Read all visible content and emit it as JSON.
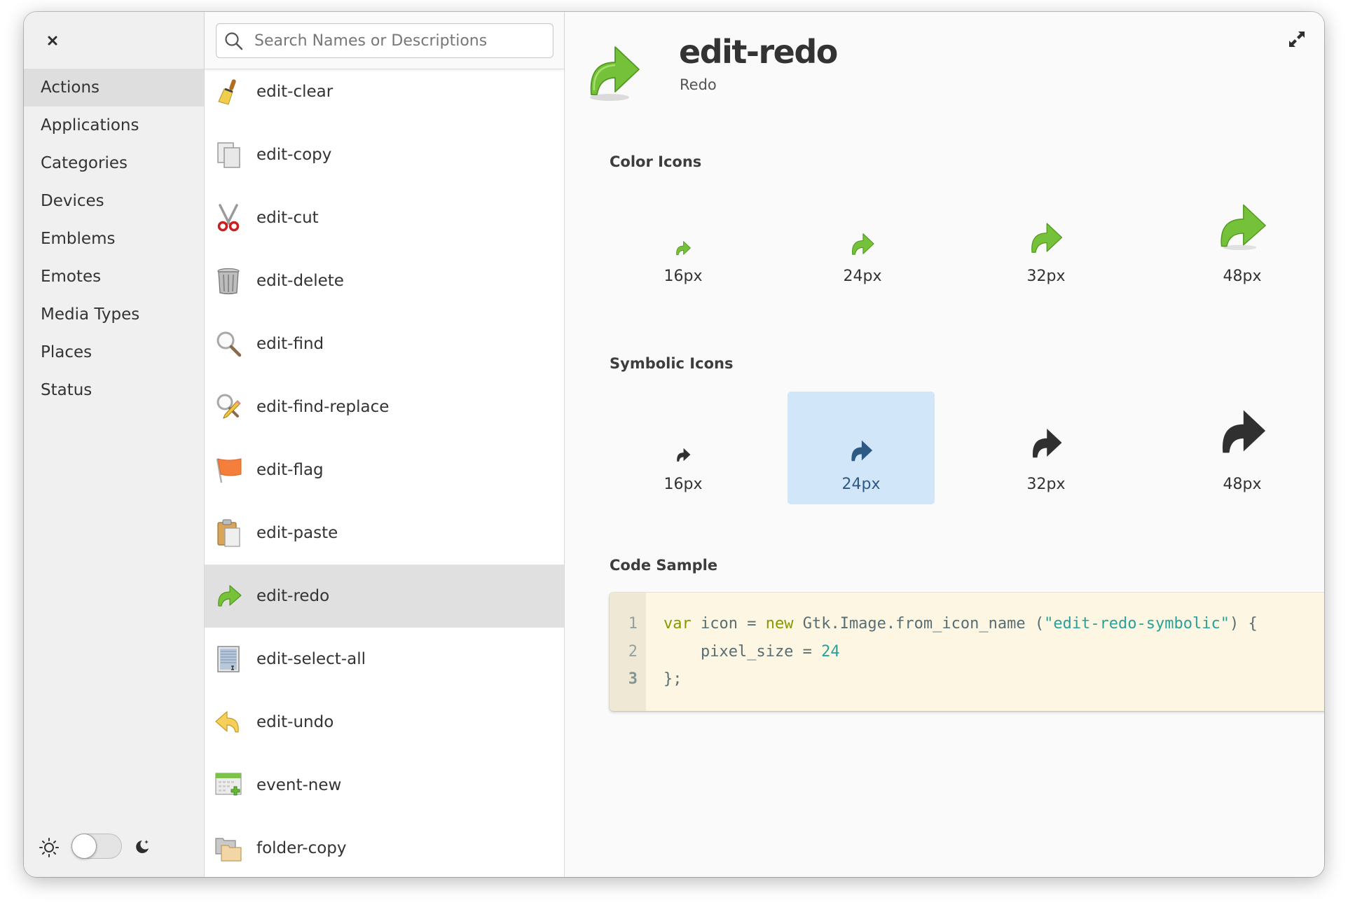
{
  "window": {
    "close_label": "close",
    "expand_label": "expand"
  },
  "sidebar": {
    "items": [
      {
        "label": "Actions",
        "active": true
      },
      {
        "label": "Applications"
      },
      {
        "label": "Categories"
      },
      {
        "label": "Devices"
      },
      {
        "label": "Emblems"
      },
      {
        "label": "Emotes"
      },
      {
        "label": "Media Types"
      },
      {
        "label": "Places"
      },
      {
        "label": "Status"
      }
    ],
    "theme_toggle": {
      "dark_mode": false,
      "light_icon": "sun-icon",
      "dark_icon": "moon-icon"
    }
  },
  "search": {
    "placeholder": "Search Names or Descriptions",
    "value": ""
  },
  "icon_list": [
    {
      "name": "edit-clear",
      "icon": "broom-icon"
    },
    {
      "name": "edit-copy",
      "icon": "copy-icon"
    },
    {
      "name": "edit-cut",
      "icon": "scissors-icon"
    },
    {
      "name": "edit-delete",
      "icon": "trash-icon"
    },
    {
      "name": "edit-find",
      "icon": "magnifier-icon"
    },
    {
      "name": "edit-find-replace",
      "icon": "find-replace-icon"
    },
    {
      "name": "edit-flag",
      "icon": "flag-icon"
    },
    {
      "name": "edit-paste",
      "icon": "clipboard-icon"
    },
    {
      "name": "edit-redo",
      "icon": "redo-arrow-icon",
      "selected": true
    },
    {
      "name": "edit-select-all",
      "icon": "select-all-icon"
    },
    {
      "name": "edit-undo",
      "icon": "undo-arrow-icon"
    },
    {
      "name": "event-new",
      "icon": "calendar-add-icon"
    },
    {
      "name": "folder-copy",
      "icon": "folder-copy-icon"
    }
  ],
  "detail": {
    "title": "edit-redo",
    "subtitle": "Redo",
    "color_heading": "Color Icons",
    "symbolic_heading": "Symbolic Icons",
    "code_heading": "Code Sample",
    "color_sizes": [
      "16px",
      "24px",
      "32px",
      "48px"
    ],
    "symbolic_sizes": [
      "16px",
      "24px",
      "32px",
      "48px"
    ],
    "selected_symbolic": "24px",
    "colors": {
      "green": "#73c236",
      "symbolic": "#303030",
      "selected_bg": "#d2e6f9",
      "selected_fg": "#2c5a85",
      "code_bg": "#fdf6e3"
    }
  },
  "code": {
    "line_numbers": [
      "1",
      "2",
      "3"
    ],
    "line1": {
      "kw1": "var",
      "t1": " icon = ",
      "kw2": "new",
      "t2": " Gtk.Image.from_icon_name (",
      "str": "\"edit-redo-symbolic\"",
      "t3": ") {"
    },
    "line2": {
      "t1": "    pixel_size = ",
      "num": "24"
    },
    "line3": {
      "t1": "};"
    }
  }
}
